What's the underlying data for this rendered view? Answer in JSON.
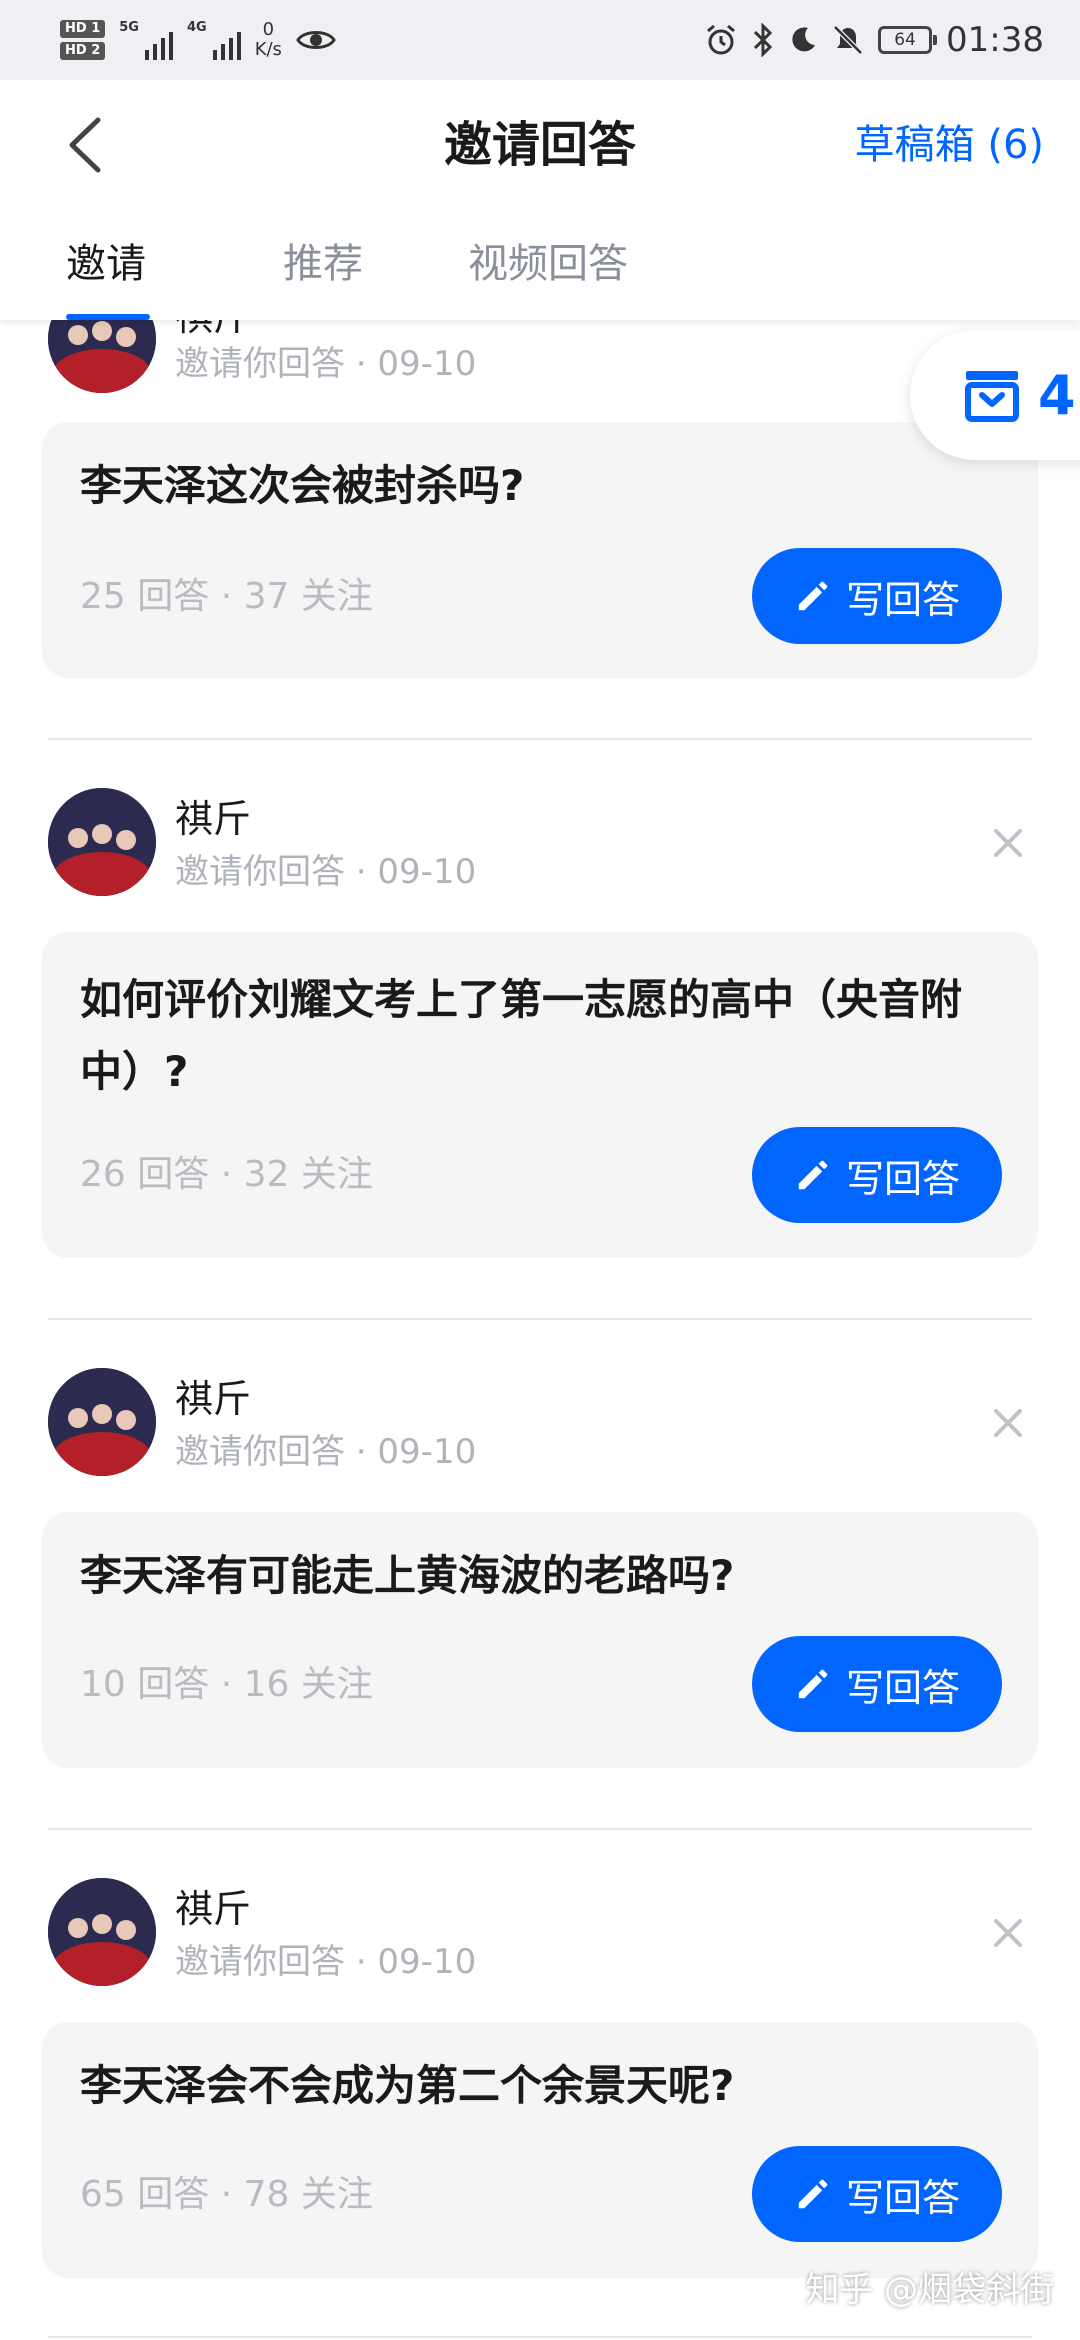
{
  "status_bar": {
    "hd_top": "HD 1",
    "hd_bottom": "HD 2",
    "net_5g": "5G",
    "net_4g": "4G",
    "speed_value": "0",
    "speed_unit": "K/s",
    "battery": "64",
    "time": "01:38"
  },
  "header": {
    "title": "邀请回答",
    "drafts": "草稿箱 (6)"
  },
  "tabs": [
    "邀请",
    "推荐",
    "视频回答"
  ],
  "active_tab": "邀请",
  "float_badge": {
    "count": "4"
  },
  "accent_color": "#0066ff",
  "write_label": "写回答",
  "items": [
    {
      "user": "祺斤",
      "meta": "邀请你回答 · 09-10",
      "question": "李天泽这次会被封杀吗?",
      "stats": "25 回答 · 37 关注"
    },
    {
      "user": "祺斤",
      "meta": "邀请你回答 · 09-10",
      "question": "如何评价刘耀文考上了第一志愿的高中（央音附中）?",
      "stats": "26 回答 · 32 关注"
    },
    {
      "user": "祺斤",
      "meta": "邀请你回答 · 09-10",
      "question": "李天泽有可能走上黄海波的老路吗?",
      "stats": "10 回答 · 16 关注"
    },
    {
      "user": "祺斤",
      "meta": "邀请你回答 · 09-10",
      "question": "李天泽会不会成为第二个余景天呢?",
      "stats": "65 回答 · 78 关注"
    }
  ],
  "watermark": "知乎 @烟袋斜街"
}
